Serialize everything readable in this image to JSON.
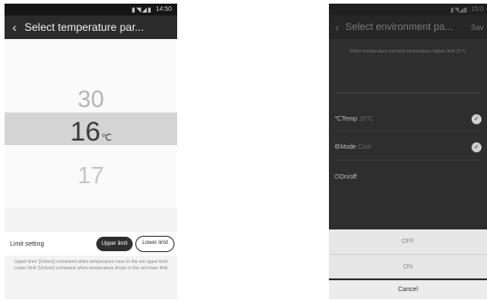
{
  "left": {
    "status_time": "14:50",
    "status_icons": "▮◥◢▮",
    "back_glyph": "‹",
    "title": "Select temperature par...",
    "picker": {
      "prev": "30",
      "current": "16",
      "unit": "℃",
      "next": "17"
    },
    "limit_label": "Limit setting",
    "upper_button": "Upper limit",
    "lower_button": "Lower limit",
    "description": "Upper limit: [Unlock] command when temperature rises to the set upper limit\nLower limit: [Unlock] command when temperature drops to the set lower limit"
  },
  "right": {
    "status_time": "15:0",
    "status_icons": "▮◥◢▮",
    "back_glyph": "‹",
    "title": "Select environment pa...",
    "action": "Sav",
    "info": "When temperature exceeds temperature higher limit 15℃",
    "rows": {
      "temp": {
        "label": "℃Temp",
        "sub": "15℃",
        "check": "✓"
      },
      "mode": {
        "label": "Mode",
        "sub": "Cool",
        "check": "✓"
      },
      "onoff": {
        "label": "On/off",
        "sub": ""
      }
    },
    "sheet_options": [
      "OFF",
      "ON"
    ],
    "cancel": "Cancel"
  }
}
